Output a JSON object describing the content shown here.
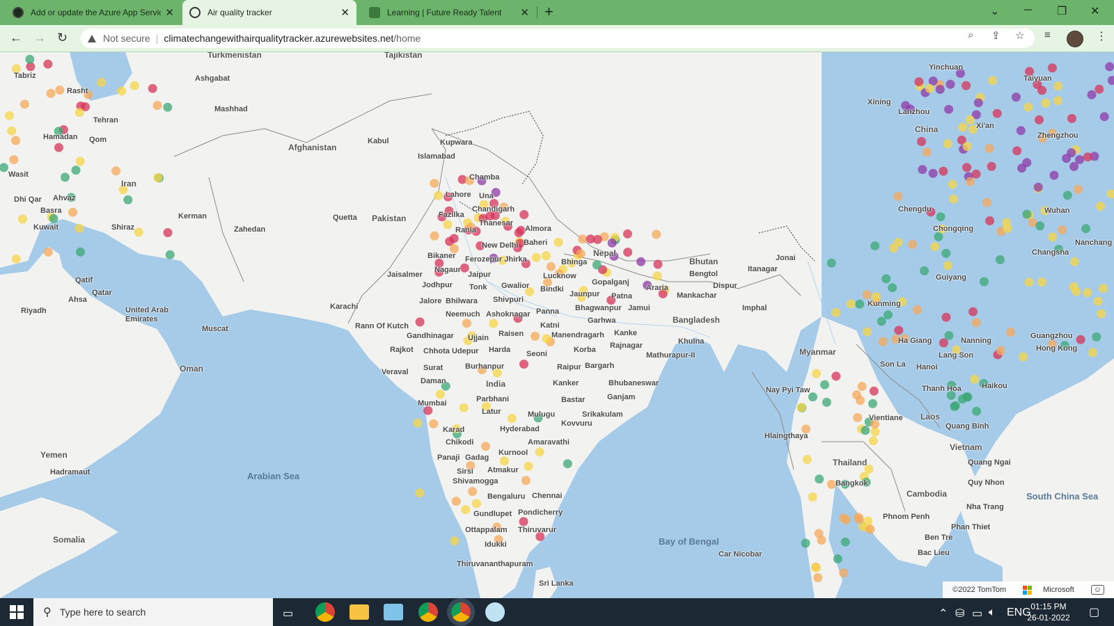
{
  "browser": {
    "tabs": [
      {
        "title": "Add or update the Azure App Servic",
        "active": false
      },
      {
        "title": "Air quality tracker",
        "active": true
      },
      {
        "title": "Learning | Future Ready Talent",
        "active": false
      }
    ],
    "security": "Not secure",
    "url_host": "climatechangewithairqualitytracker.azurewebsites.net",
    "url_path": "/home"
  },
  "map": {
    "countries": [
      "Turkmenistan",
      "Tajikistan",
      "Afghanistan",
      "Iran",
      "Pakistan",
      "India",
      "Nepal",
      "Bhutan",
      "Bangladesh",
      "Myanmar",
      "China",
      "Thailand",
      "Laos",
      "Vietnam",
      "Cambodia",
      "Oman",
      "Yemen",
      "Somalia",
      "United Arab Emirates"
    ],
    "seas": [
      "Arabian Sea",
      "Bay of Bengal",
      "South China Sea"
    ],
    "cities": [
      "Tabriz",
      "Rasht",
      "Tehran",
      "Hamadan",
      "Qom",
      "Ashgabat",
      "Mashhad",
      "Kabul",
      "Kupwara",
      "Islamabad",
      "Chamba",
      "Lahore",
      "Una",
      "Chandigarh",
      "Fazilka",
      "Thanesar",
      "Rania",
      "Almora",
      "New Delhi",
      "Baheri",
      "Bhinga",
      "Bikaner",
      "Ferozepur Jhirka",
      "Lucknow",
      "Jaisalmer",
      "Nagaur",
      "Jaipur",
      "Jodhpur",
      "Tonk",
      "Gwalior",
      "Bindki",
      "Jaunpur",
      "Gopalganj",
      "Araria",
      "Patna",
      "Jalore",
      "Bhilwara",
      "Shivpuri",
      "Bhagwanpur",
      "Jamui",
      "Neemuch",
      "Ashoknagar",
      "Panna",
      "Garhwa",
      "Katni",
      "Kanke",
      "Rann Of Kutch",
      "Gandhinagar",
      "Ujjain",
      "Raisen",
      "Manendragarh",
      "Rajnagar",
      "Khulna",
      "Rajkot",
      "Chhota Udepur",
      "Harda",
      "Seoni",
      "Korba",
      "Mathurapur-II",
      "Veraval",
      "Surat",
      "Burhanpur",
      "Raipur",
      "Bargarh",
      "Daman",
      "India",
      "Kanker",
      "Bhubaneswar",
      "Mumbai",
      "Parbhani",
      "Bastar",
      "Ganjam",
      "Latur",
      "Mulugu",
      "Srikakulam",
      "Kovvuru",
      "Karad",
      "Hyderabad",
      "Chikodi",
      "Amaravathi",
      "Panaji",
      "Gadag",
      "Kurnool",
      "Sirsi",
      "Atmakur",
      "Shivamogga",
      "Bengaluru",
      "Chennai",
      "Gundlupet",
      "Pondicherry",
      "Ottappalam",
      "Thiruvarur",
      "Idukki",
      "Thiruvananthapuram",
      "Sri Lanka",
      "Karachi",
      "Quetta",
      "Zahedan",
      "Kerman",
      "Shiraz",
      "Ahvaz",
      "Basra",
      "Kuwait",
      "Wasit",
      "Dhi Qar",
      "Qatif",
      "Qatar",
      "Ahsa",
      "Riyadh",
      "Muscat",
      "Hadramaut",
      "Xining",
      "Lanzhou",
      "Yinchuan",
      "Taiyuan",
      "Xi'an",
      "Zhengzhou",
      "Chengdu",
      "Chongqing",
      "Wuhan",
      "Changsha",
      "Nanchang",
      "Guiyang",
      "Kunming",
      "Guangzhou",
      "Hong Kong",
      "Nanning",
      "Ha Giang",
      "Lang Son",
      "Hanoi",
      "Son La",
      "Haikou",
      "Thanh Hoa",
      "Quang Binh",
      "Quang Ngai",
      "Quy Nhon",
      "Nha Trang",
      "Phan Thiet",
      "Ben Tre",
      "Bac Lieu",
      "Phnom Penh",
      "Vientiane",
      "Bangkok",
      "Nay Pyi Taw",
      "Hlaingthaya",
      "Itanagar",
      "Jonai",
      "Bengtol",
      "Dispur",
      "Mankachar",
      "Imphal",
      "Car Nicobar",
      "Kupwara"
    ],
    "copyright": "©2022 TomTom",
    "brand": "Microsoft",
    "aqi_colors": {
      "good": "#3aa876",
      "moderate": "#f5d547",
      "sensitive": "#f6a85a",
      "unhealthy": "#d6335a",
      "very_unhealthy": "#8e3aa8"
    }
  },
  "taskbar": {
    "search_placeholder": "Type here to search",
    "language": "ENG",
    "time": "01:15 PM",
    "date": "26-01-2022"
  }
}
